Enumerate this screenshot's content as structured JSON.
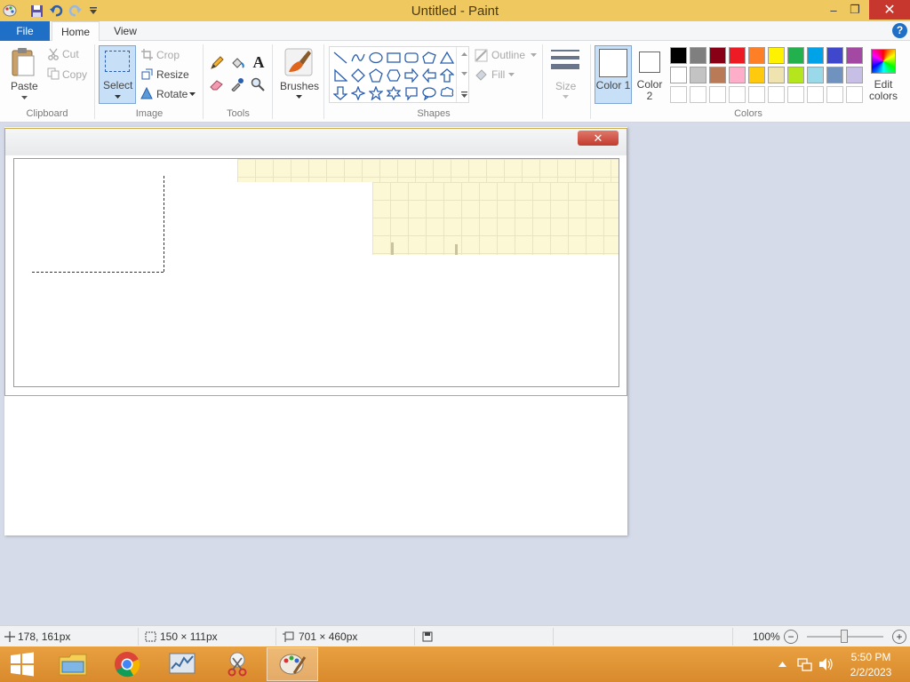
{
  "window": {
    "title": "Untitled - Paint",
    "minimize": "–",
    "restore": "❐",
    "close": "✕"
  },
  "tabs": {
    "file": "File",
    "home": "Home",
    "view": "View",
    "help": "?"
  },
  "clipboard": {
    "paste": "Paste",
    "cut": "Cut",
    "copy": "Copy",
    "label": "Clipboard"
  },
  "image": {
    "select": "Select",
    "crop": "Crop",
    "resize": "Resize",
    "rotate": "Rotate",
    "label": "Image"
  },
  "tools": {
    "label": "Tools"
  },
  "brushes": {
    "label": "Brushes"
  },
  "shapes": {
    "outline": "Outline",
    "fill": "Fill",
    "label": "Shapes"
  },
  "size": {
    "label": "Size"
  },
  "colors": {
    "color1": "Color 1",
    "color2": "Color 2",
    "edit": "Edit colors",
    "label": "Colors",
    "palette_row1": [
      "#000000",
      "#7f7f7f",
      "#880015",
      "#ed1c24",
      "#ff7f27",
      "#fff200",
      "#22b14c",
      "#00a2e8",
      "#3f48cc",
      "#a349a4"
    ],
    "palette_row2": [
      "#ffffff",
      "#c3c3c3",
      "#b97a57",
      "#ffaec9",
      "#ffc90e",
      "#efe4b0",
      "#b5e61d",
      "#99d9ea",
      "#7092be",
      "#c8bfe7"
    ]
  },
  "pasted_window": {
    "close": "✕"
  },
  "status": {
    "cursor": "178, 161px",
    "selection": "150 × 111px",
    "canvas_size": "701 × 460px",
    "zoom": "100%",
    "zoom_out": "−",
    "zoom_in": "+"
  },
  "taskbar": {
    "time": "5:50 PM",
    "date": "2/2/2023"
  }
}
